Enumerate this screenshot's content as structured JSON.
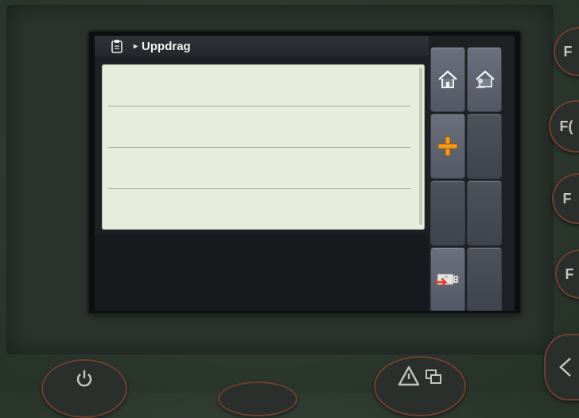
{
  "screen": {
    "title": "Uppdrag",
    "breadcrumb_icon": "clipboard-icon",
    "breadcrumb_separator": "▸",
    "list_rows": [
      "",
      "",
      "",
      ""
    ]
  },
  "softkeys": [
    {
      "id": "home",
      "icon": "home-icon"
    },
    {
      "id": "home-user",
      "icon": "home-user-icon"
    },
    {
      "id": "add",
      "icon": "plus-icon"
    },
    {
      "id": "empty-1",
      "icon": ""
    },
    {
      "id": "empty-2",
      "icon": ""
    },
    {
      "id": "empty-3",
      "icon": ""
    },
    {
      "id": "usb-import",
      "icon": "usb-import-icon"
    },
    {
      "id": "empty-4",
      "icon": ""
    }
  ],
  "hardware_keys": {
    "f1_label": "F",
    "f2_label": "F(",
    "f3_label": "F",
    "f4_label": "F"
  },
  "colors": {
    "accent_orange": "#f39a1d",
    "softkey": "#5f6571",
    "list_background": "#e7ecdd"
  }
}
